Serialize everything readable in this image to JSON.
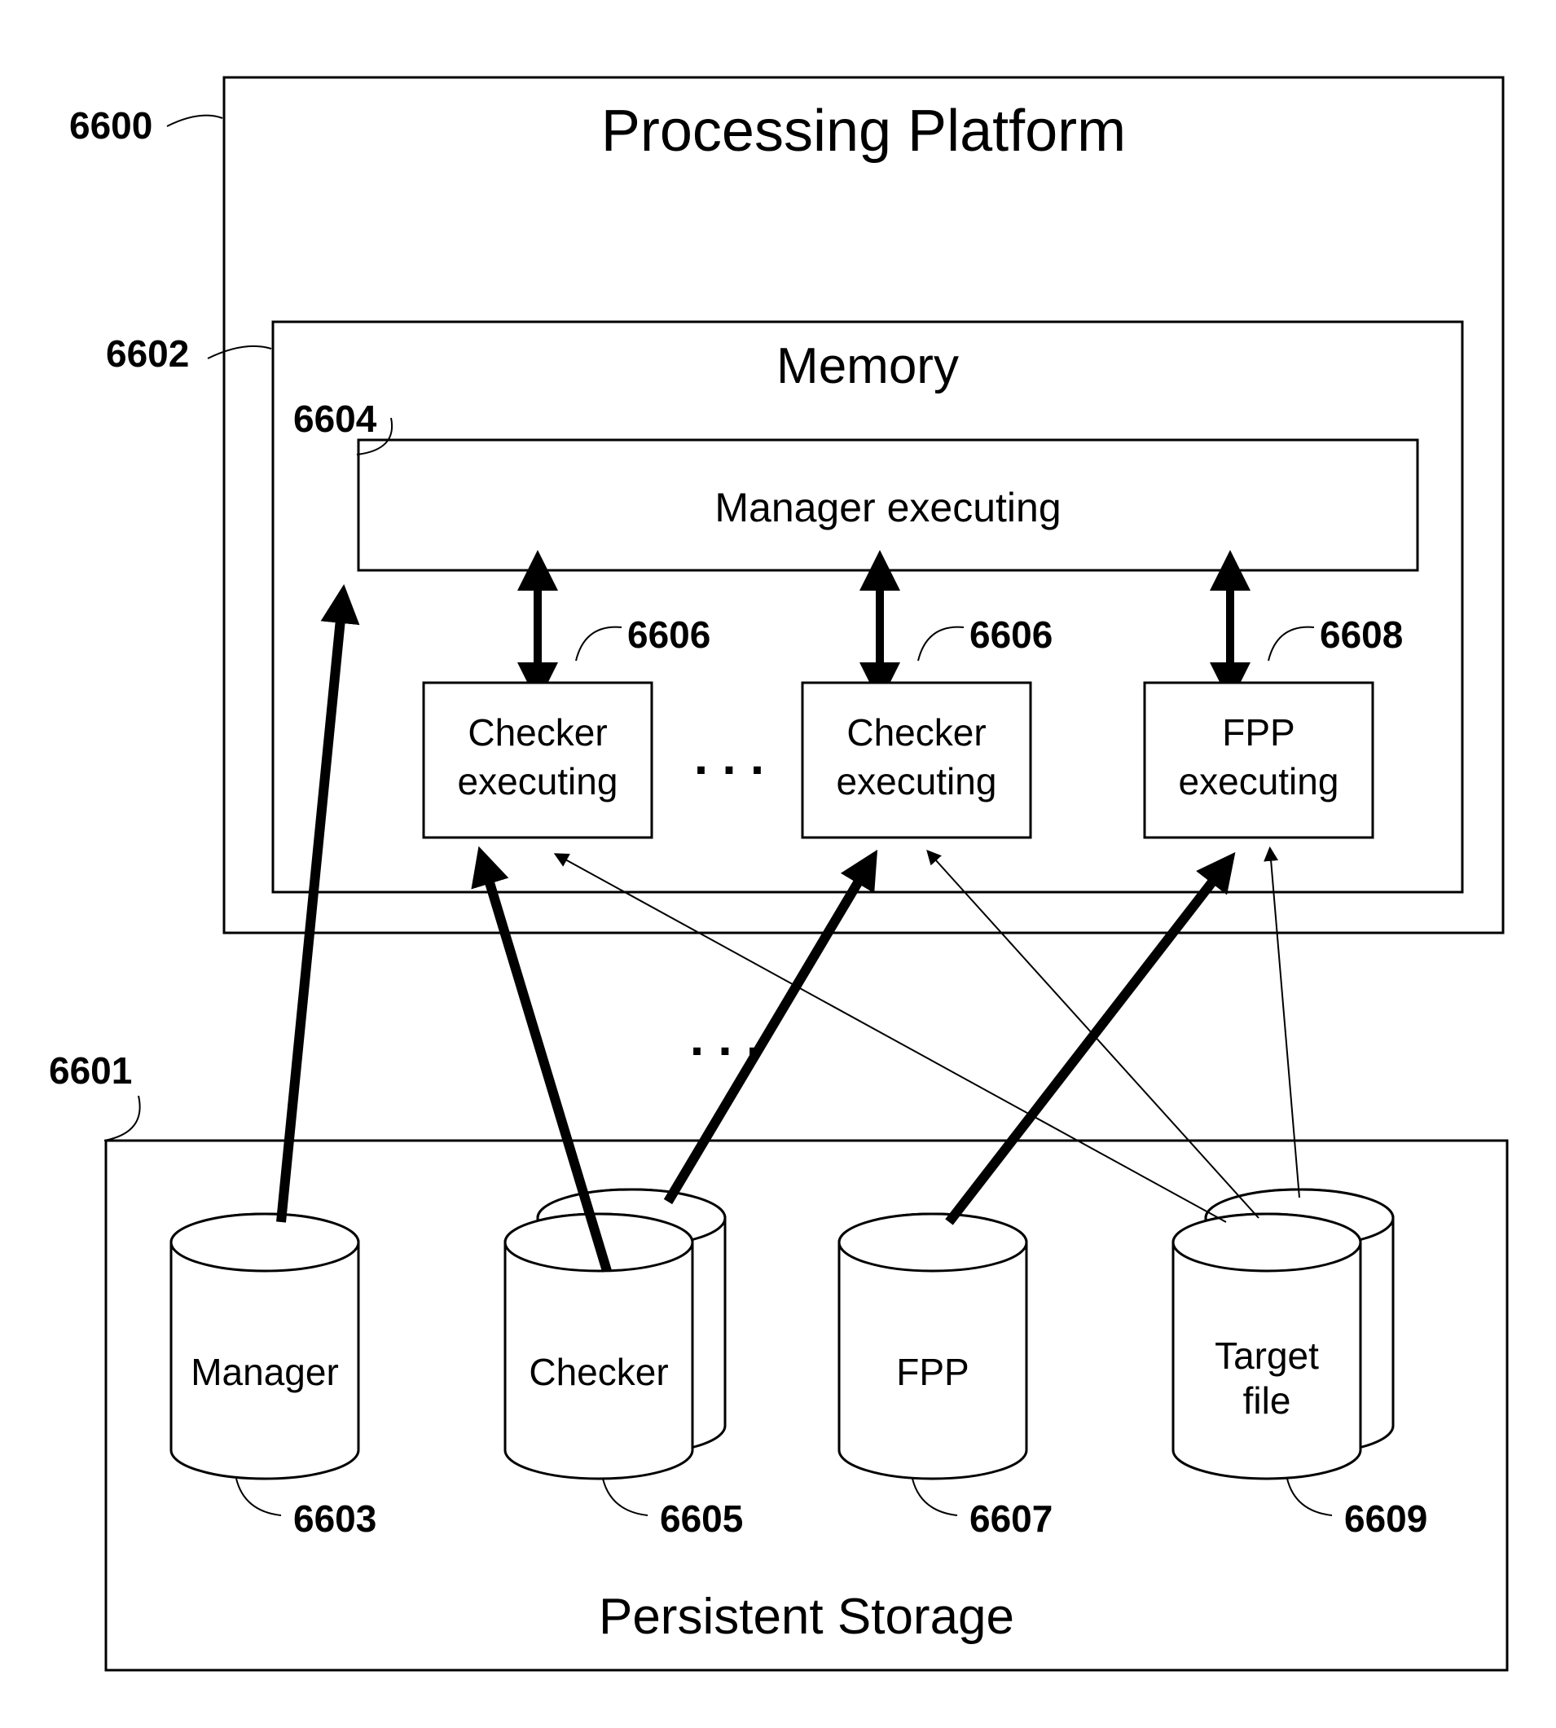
{
  "titles": {
    "processing_platform": "Processing Platform",
    "memory": "Memory",
    "persistent_storage": "Persistent Storage"
  },
  "blocks": {
    "manager_exec": "Manager executing",
    "checker_exec": "Checker\nexecuting",
    "fpp_exec": "FPP\nexecuting"
  },
  "cylinders": {
    "manager": "Manager",
    "checker": "Checker",
    "fpp": "FPP",
    "target": "Target\nfile"
  },
  "ellipsis": ". . .",
  "refs": {
    "r6600": "6600",
    "r6601": "6601",
    "r6602": "6602",
    "r6603": "6603",
    "r6604": "6604",
    "r6605": "6605",
    "r6606a": "6606",
    "r6606b": "6606",
    "r6607": "6607",
    "r6608": "6608",
    "r6609": "6609"
  }
}
